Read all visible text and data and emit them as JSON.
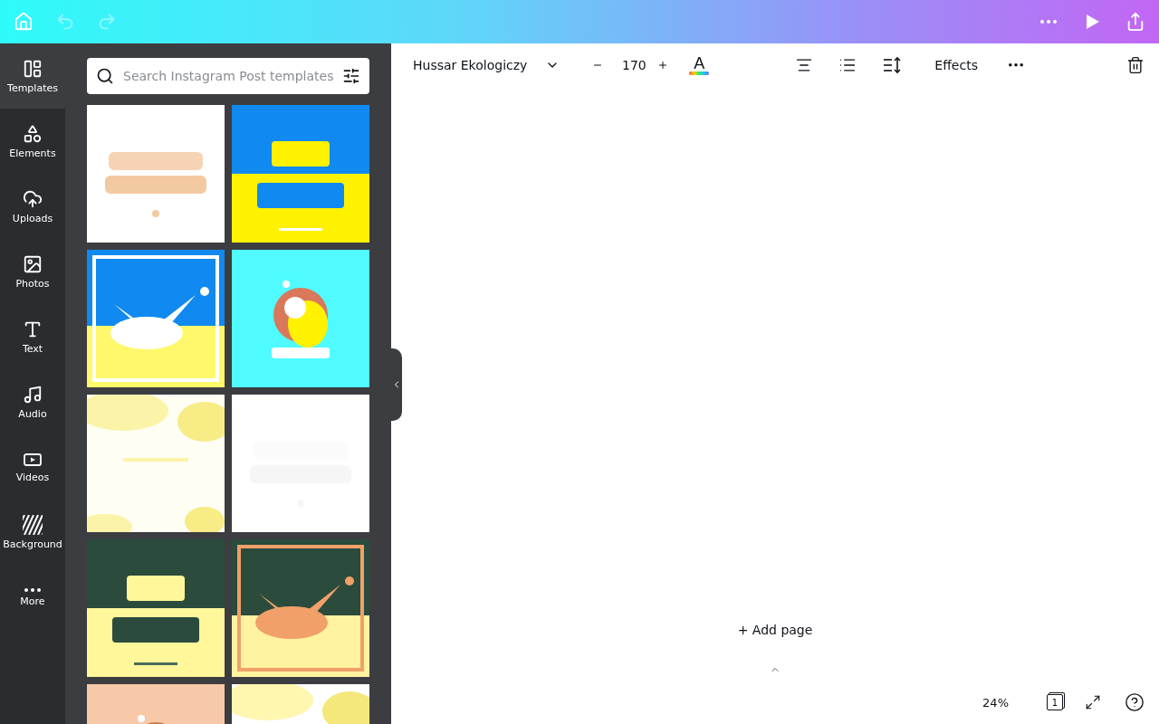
{
  "top_bar": {
    "undo": {
      "disabled": true
    },
    "redo": {
      "disabled": true
    }
  },
  "sidebar": {
    "items": [
      {
        "label": "Templates",
        "selected": true
      },
      {
        "label": "Elements",
        "selected": false
      },
      {
        "label": "Uploads",
        "selected": false
      },
      {
        "label": "Photos",
        "selected": false
      },
      {
        "label": "Text",
        "selected": false
      },
      {
        "label": "Audio",
        "selected": false
      },
      {
        "label": "Videos",
        "selected": false
      },
      {
        "label": "Background",
        "selected": false
      },
      {
        "label": "More",
        "selected": false
      }
    ]
  },
  "search": {
    "placeholder": "Search Instagram Post templates"
  },
  "toolbar": {
    "font": "Hussar Ekologiczy",
    "font_size": "170",
    "text_color_glyph": "A",
    "effects": "Effects"
  },
  "canvas": {
    "add_page": "+ Add page"
  },
  "footer": {
    "zoom": "24%",
    "page": "1"
  }
}
